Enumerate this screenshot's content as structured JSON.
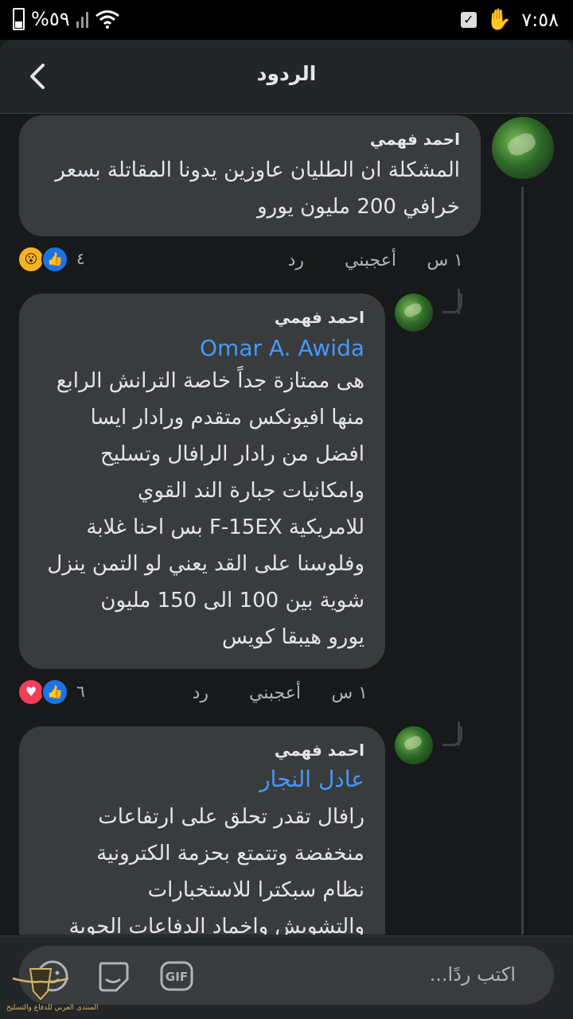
{
  "status_bar": {
    "battery": "%٥٩",
    "time": "٧:٥٨"
  },
  "header": {
    "title": "الردود"
  },
  "comments": [
    {
      "author": "احمد فهمي",
      "text": "المشكلة ان الطليان عاوزين يدونا المقاتلة بسعر\nخرافي 200 مليون يورو",
      "time": "١ س",
      "like_label": "أعجبني",
      "reply_label": "رد",
      "reaction_count": "٤",
      "reactions": [
        "like-icon",
        "wow-icon"
      ]
    },
    {
      "author": "احمد فهمي",
      "mention": "Omar A. Awida",
      "text": "هى ممتازة جداً خاصة الترانش الرابع\nمنها افيونكس متقدم ورادار ايسا\nافضل من رادار الرافال وتسليح\nوامكانيات جبارة الند القوي\nللامريكية F-15EX بس احنا غلابة\nوفلوسنا على القد يعني لو التمن ينزل\nشوية بين 100 الى 150 مليون\nيورو هيبقا كويس",
      "time": "١ س",
      "like_label": "أعجبني",
      "reply_label": "رد",
      "reaction_count": "٦",
      "reactions": [
        "like-icon",
        "love-icon"
      ]
    },
    {
      "author": "احمد فهمي",
      "mention": "عادل النجار",
      "text": "رافال تقدر تحلق على ارتفاعات\nمنخفضة وتتمتع بحزمة الكترونية\nنظام سبكترا للاستخبارات\nوالتشويش واخماد الدفاعات الجوية"
    }
  ],
  "composer": {
    "placeholder": "اكتب ردًا...",
    "gif_label": "GIF",
    "watermark": "المنتدى العربي للدفاع والتسليح"
  }
}
